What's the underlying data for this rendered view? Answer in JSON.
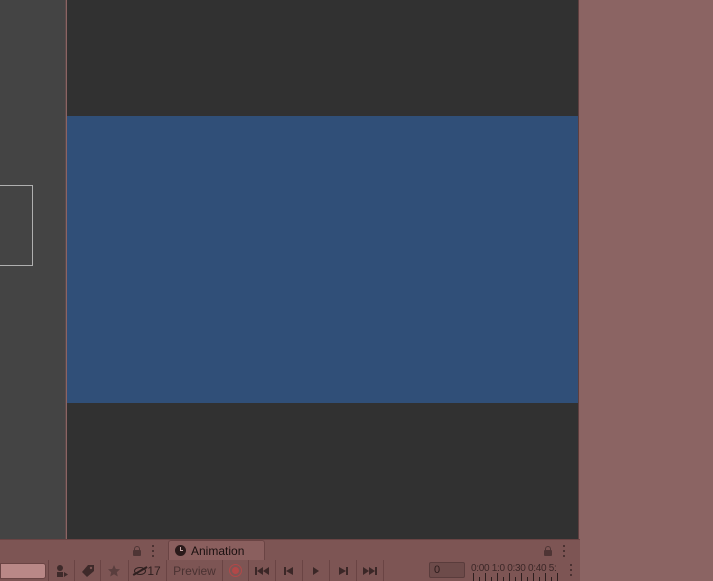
{
  "scene": {
    "background_color": "#313131",
    "game_rect_color": "#304f78"
  },
  "hierarchy_panel": {
    "icons": [
      "lock-icon",
      "more-options-icon"
    ],
    "tools": [
      {
        "name": "scene-visibility-icon"
      },
      {
        "name": "tag-icon"
      },
      {
        "name": "star-icon"
      }
    ],
    "hidden_count": "17"
  },
  "animation_panel": {
    "tab_label": "Animation",
    "preview_label": "Preview",
    "frame_value": "0",
    "timeline_labels": "0:00 1:0 0:30 0:40 5:",
    "icons": [
      "clock-icon",
      "lock-icon",
      "more-options-icon",
      "record-icon",
      "first-key-icon",
      "prev-key-icon",
      "play-icon",
      "next-key-icon",
      "last-key-icon"
    ]
  },
  "colors": {
    "editor_tint": "#8b6463",
    "record": "#b24848"
  }
}
